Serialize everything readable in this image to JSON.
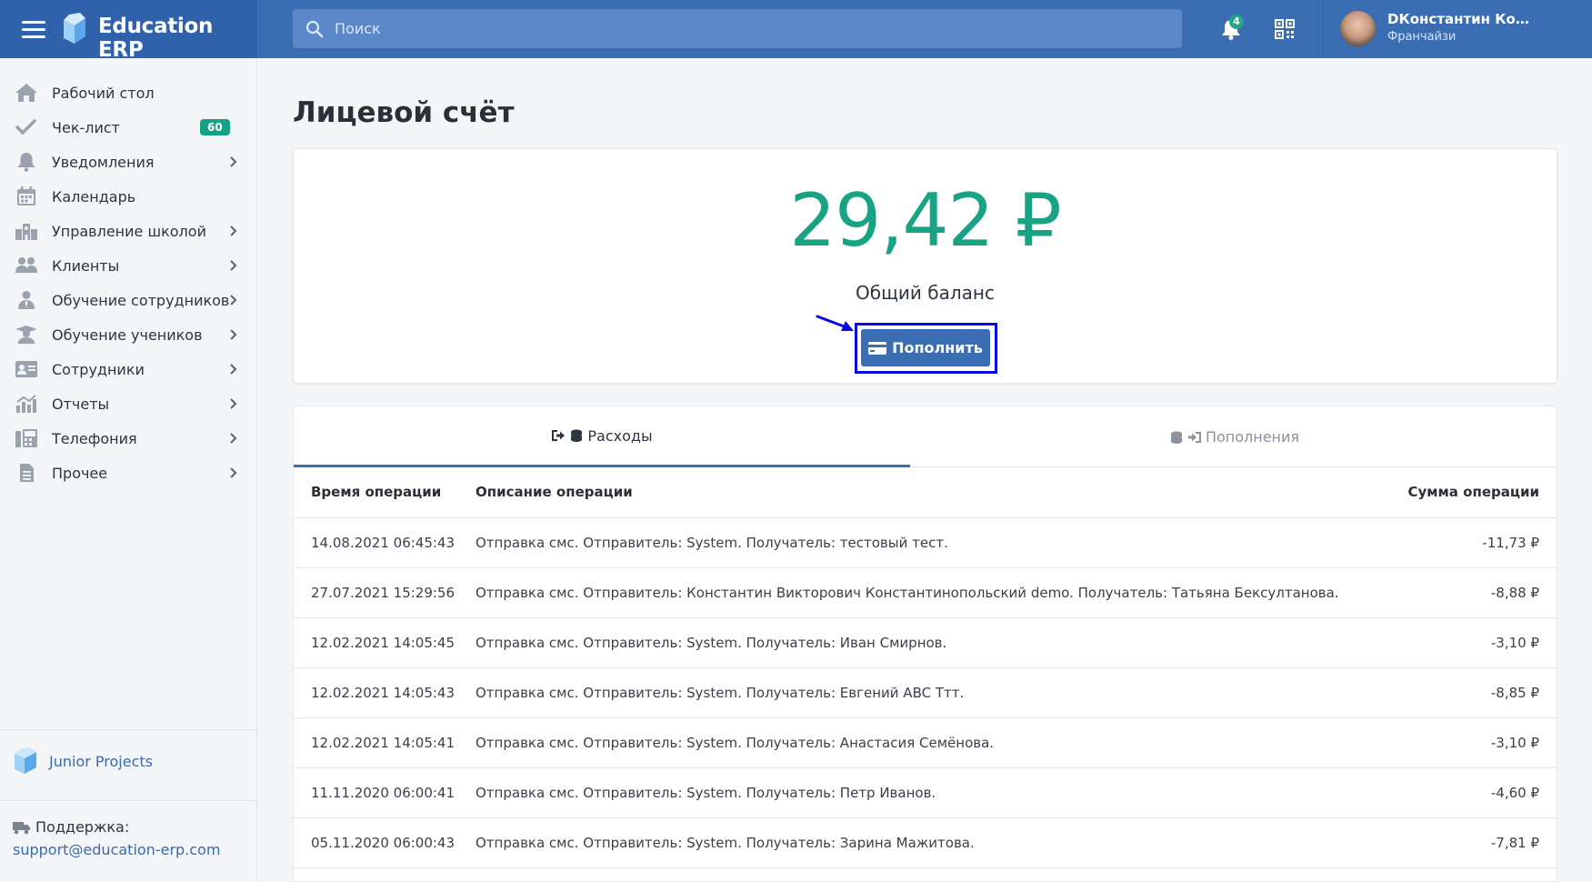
{
  "app": {
    "brand": "Education ERP",
    "search_placeholder": "Поиск",
    "notifications_count": "4",
    "user_name": "DКонстантин Конс...",
    "user_role": "Франчайзи"
  },
  "colors": {
    "brand_blue": "#3b6db3",
    "balance_green": "#17a384",
    "badge_green": "#16a085",
    "highlight_blue": "#0a08e0"
  },
  "sidebar": {
    "items": [
      {
        "label": "Рабочий стол",
        "icon": "home-icon",
        "chevron": false
      },
      {
        "label": "Чек-лист",
        "icon": "check-icon",
        "badge": "60",
        "chevron": false
      },
      {
        "label": "Уведомления",
        "icon": "bell-icon",
        "chevron": true
      },
      {
        "label": "Календарь",
        "icon": "calendar-icon",
        "chevron": false
      },
      {
        "label": "Управление школой",
        "icon": "school-icon",
        "chevron": true
      },
      {
        "label": "Клиенты",
        "icon": "users-icon",
        "chevron": true
      },
      {
        "label": "Обучение сотрудников",
        "icon": "user-tie-icon",
        "chevron": true
      },
      {
        "label": "Обучение учеников",
        "icon": "graduate-icon",
        "chevron": true
      },
      {
        "label": "Сотрудники",
        "icon": "id-card-icon",
        "chevron": true
      },
      {
        "label": "Отчеты",
        "icon": "chart-icon",
        "chevron": true
      },
      {
        "label": "Телефония",
        "icon": "fax-icon",
        "chevron": true
      },
      {
        "label": "Прочее",
        "icon": "file-icon",
        "chevron": true
      }
    ],
    "project_name": "Junior Projects",
    "support_label": "Поддержка:",
    "support_email": "support@education-erp.com"
  },
  "page": {
    "title": "Лицевой счёт",
    "balance_amount": "29,42 ₽",
    "balance_label": "Общий баланс",
    "topup_button": "Пополнить"
  },
  "tabs": [
    {
      "label": "Расходы",
      "active": true
    },
    {
      "label": "Пополнения",
      "active": false
    }
  ],
  "table": {
    "headers": [
      "Время операции",
      "Описание операции",
      "Сумма операции"
    ],
    "rows": [
      [
        "14.08.2021 06:45:43",
        "Отправка смс. Отправитель: System. Получатель: тестовый тест.",
        "-11,73 ₽"
      ],
      [
        "27.07.2021 15:29:56",
        "Отправка смс. Отправитель: Константин Викторович Константинопольский demo. Получатель: Татьяна Бексултанова.",
        "-8,88 ₽"
      ],
      [
        "12.02.2021 14:05:45",
        "Отправка смс. Отправитель: System. Получатель: Иван Смирнов.",
        "-3,10 ₽"
      ],
      [
        "12.02.2021 14:05:43",
        "Отправка смс. Отправитель: System. Получатель: Евгений ABC Ттт.",
        "-8,85 ₽"
      ],
      [
        "12.02.2021 14:05:41",
        "Отправка смс. Отправитель: System. Получатель: Анастасия Семёнова.",
        "-3,10 ₽"
      ],
      [
        "11.11.2020 06:00:41",
        "Отправка смс. Отправитель: System. Получатель: Петр Иванов.",
        "-4,60 ₽"
      ],
      [
        "05.11.2020 06:00:43",
        "Отправка смс. Отправитель: System. Получатель: Зарина Мажитова.",
        "-7,81 ₽"
      ]
    ]
  }
}
